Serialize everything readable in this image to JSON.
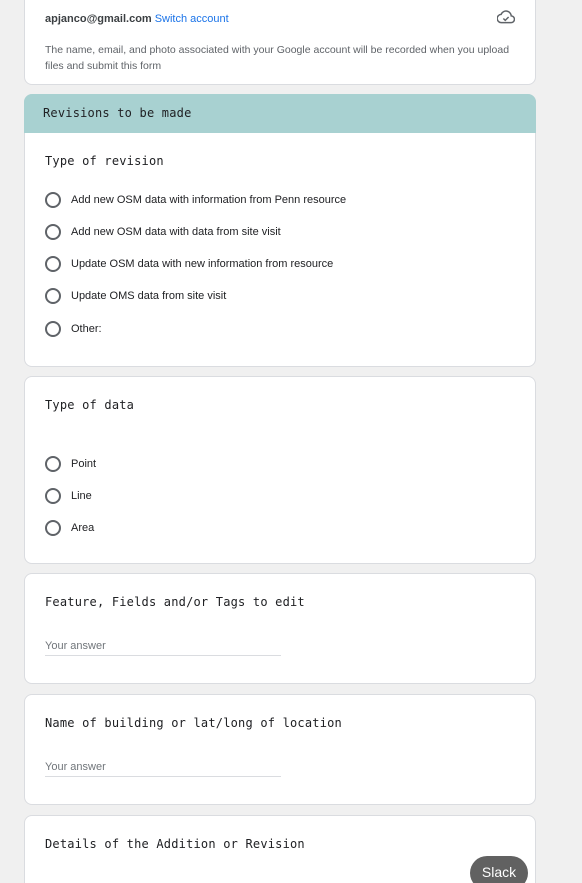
{
  "account": {
    "email": "apjanco@gmail.com",
    "switch_label": "Switch account",
    "notice": "The name, email, and photo associated with your Google account will be recorded when you upload files and submit this form"
  },
  "section": {
    "title": "Revisions to be made"
  },
  "revision": {
    "question": "Type of revision",
    "options": [
      "Add new OSM data with information from Penn resource",
      "Add new OSM data with data from site visit",
      "Update OSM data with new information from resource",
      "Update OMS data from site visit",
      "Other:"
    ]
  },
  "data_type": {
    "question": "Type of data",
    "options": [
      "Point",
      "Line",
      "Area"
    ]
  },
  "feature": {
    "question": "Feature, Fields and/or Tags to edit",
    "placeholder": "Your answer"
  },
  "location": {
    "question": "Name of building or lat/long of location",
    "placeholder": "Your answer"
  },
  "details": {
    "question": "Details of the Addition or Revision"
  },
  "slack": {
    "label": "Slack"
  }
}
